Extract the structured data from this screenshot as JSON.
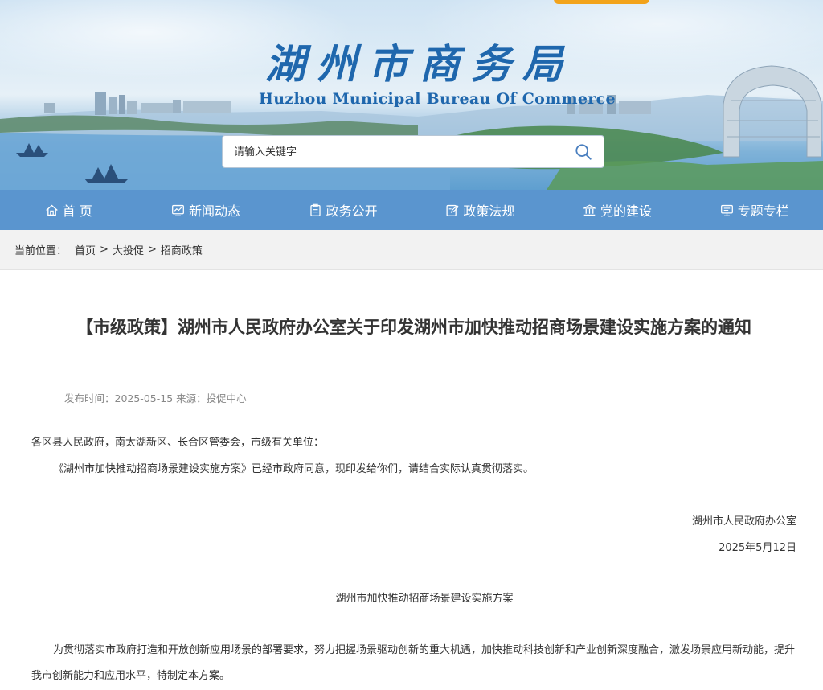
{
  "header": {
    "site_title": "湖州市商务局",
    "site_subtitle": "Huzhou Municipal Bureau Of Commerce",
    "search_placeholder": "请输入关键字"
  },
  "nav": {
    "items": [
      {
        "label": "首 页",
        "icon": "home-icon"
      },
      {
        "label": "新闻动态",
        "icon": "chart-icon"
      },
      {
        "label": "政务公开",
        "icon": "clipboard-icon"
      },
      {
        "label": "政策法规",
        "icon": "edit-icon"
      },
      {
        "label": "党的建设",
        "icon": "building-icon"
      },
      {
        "label": "专题专栏",
        "icon": "monitor-icon"
      }
    ]
  },
  "breadcrumb": {
    "label": "当前位置：",
    "items": [
      "首页",
      "大投促",
      "招商政策"
    ],
    "separator": ">"
  },
  "article": {
    "title": "【市级政策】湖州市人民政府办公室关于印发湖州市加快推动招商场景建设实施方案的通知",
    "meta": "发布时间：2025-05-15 来源：投促中心",
    "greeting": "各区县人民政府，南太湖新区、长合区管委会，市级有关单位：",
    "body1": "《湖州市加快推动招商场景建设实施方案》已经市政府同意，现印发给你们，请结合实际认真贯彻落实。",
    "signature": "湖州市人民政府办公室",
    "date": "2025年5月12日",
    "subtitle": "湖州市加快推动招商场景建设实施方案",
    "body2_line1": "为贯彻落实市政府打造和开放创新应用场景的部署要求，努力把握场景驱动创新的重大机遇，加快推动科技创新和产业创新深度融合，激发场景应用新动能，提升",
    "body2_line2": "我市创新能力和应用水平，特制定本方案。"
  }
}
